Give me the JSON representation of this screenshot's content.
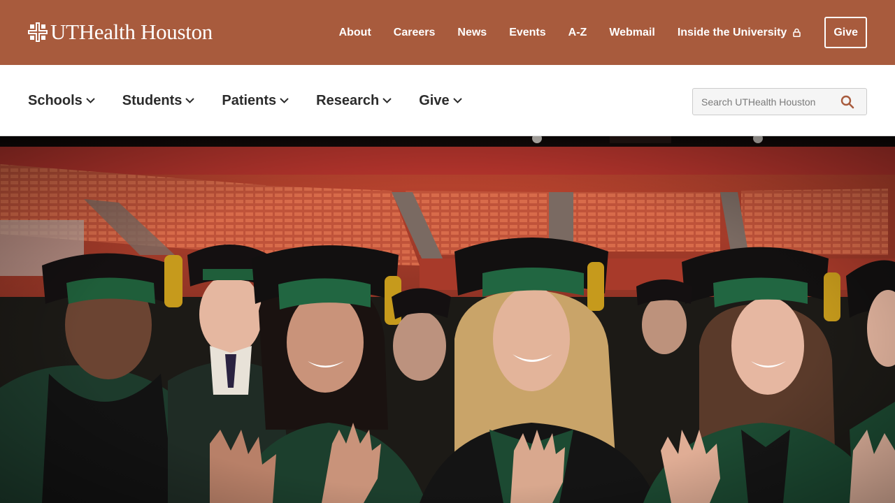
{
  "brand": {
    "name": "UTHealth Houston",
    "accent_color": "#a85b3d"
  },
  "utility_nav": {
    "links": [
      {
        "label": "About"
      },
      {
        "label": "Careers"
      },
      {
        "label": "News"
      },
      {
        "label": "Events"
      },
      {
        "label": "A-Z"
      },
      {
        "label": "Webmail"
      },
      {
        "label": "Inside the University",
        "icon": "lock-icon"
      }
    ],
    "give_label": "Give"
  },
  "main_nav": {
    "items": [
      {
        "label": "Schools"
      },
      {
        "label": "Students"
      },
      {
        "label": "Patients"
      },
      {
        "label": "Research"
      },
      {
        "label": "Give"
      }
    ]
  },
  "search": {
    "placeholder": "Search UTHealth Houston",
    "value": ""
  },
  "hero": {
    "image_description_icon": "graduates-photo"
  }
}
